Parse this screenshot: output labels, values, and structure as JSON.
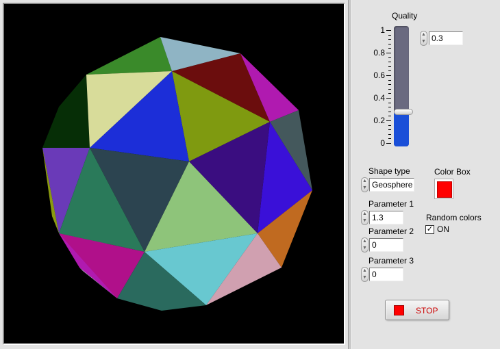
{
  "quality": {
    "label": "Quality",
    "value_text": "0.3",
    "fraction": 0.3,
    "ticks": [
      "1",
      "0.8",
      "0.6",
      "0.4",
      "0.2",
      "0"
    ]
  },
  "shape_type": {
    "label": "Shape type",
    "value": "Geosphere"
  },
  "color_box": {
    "label": "Color Box",
    "color": "#ff0000"
  },
  "parameter1": {
    "label": "Parameter 1",
    "value": "1.3"
  },
  "parameter2": {
    "label": "Parameter 2",
    "value": "0"
  },
  "parameter3": {
    "label": "Parameter 3",
    "value": "0"
  },
  "random_colors": {
    "label": "Random colors",
    "checked": true,
    "state_text": "ON"
  },
  "stop_button": {
    "label": "STOP",
    "led_color": "#ff0000"
  },
  "scene": {
    "background": "#000000",
    "face_colors": [
      "#3a8a2a",
      "#8fb4c4",
      "#6b0d0d",
      "#b01ab0",
      "#d8dc9a",
      "#1c2ed8",
      "#7f9a10",
      "#062e06",
      "#2c4450",
      "#3a0d80",
      "#3a10d8",
      "#44585c",
      "#2a7a5a",
      "#6a3ab8",
      "#8ec47a",
      "#c06a20",
      "#b0108a",
      "#68c8d0",
      "#d0a0b0",
      "#2a6a5e"
    ]
  }
}
